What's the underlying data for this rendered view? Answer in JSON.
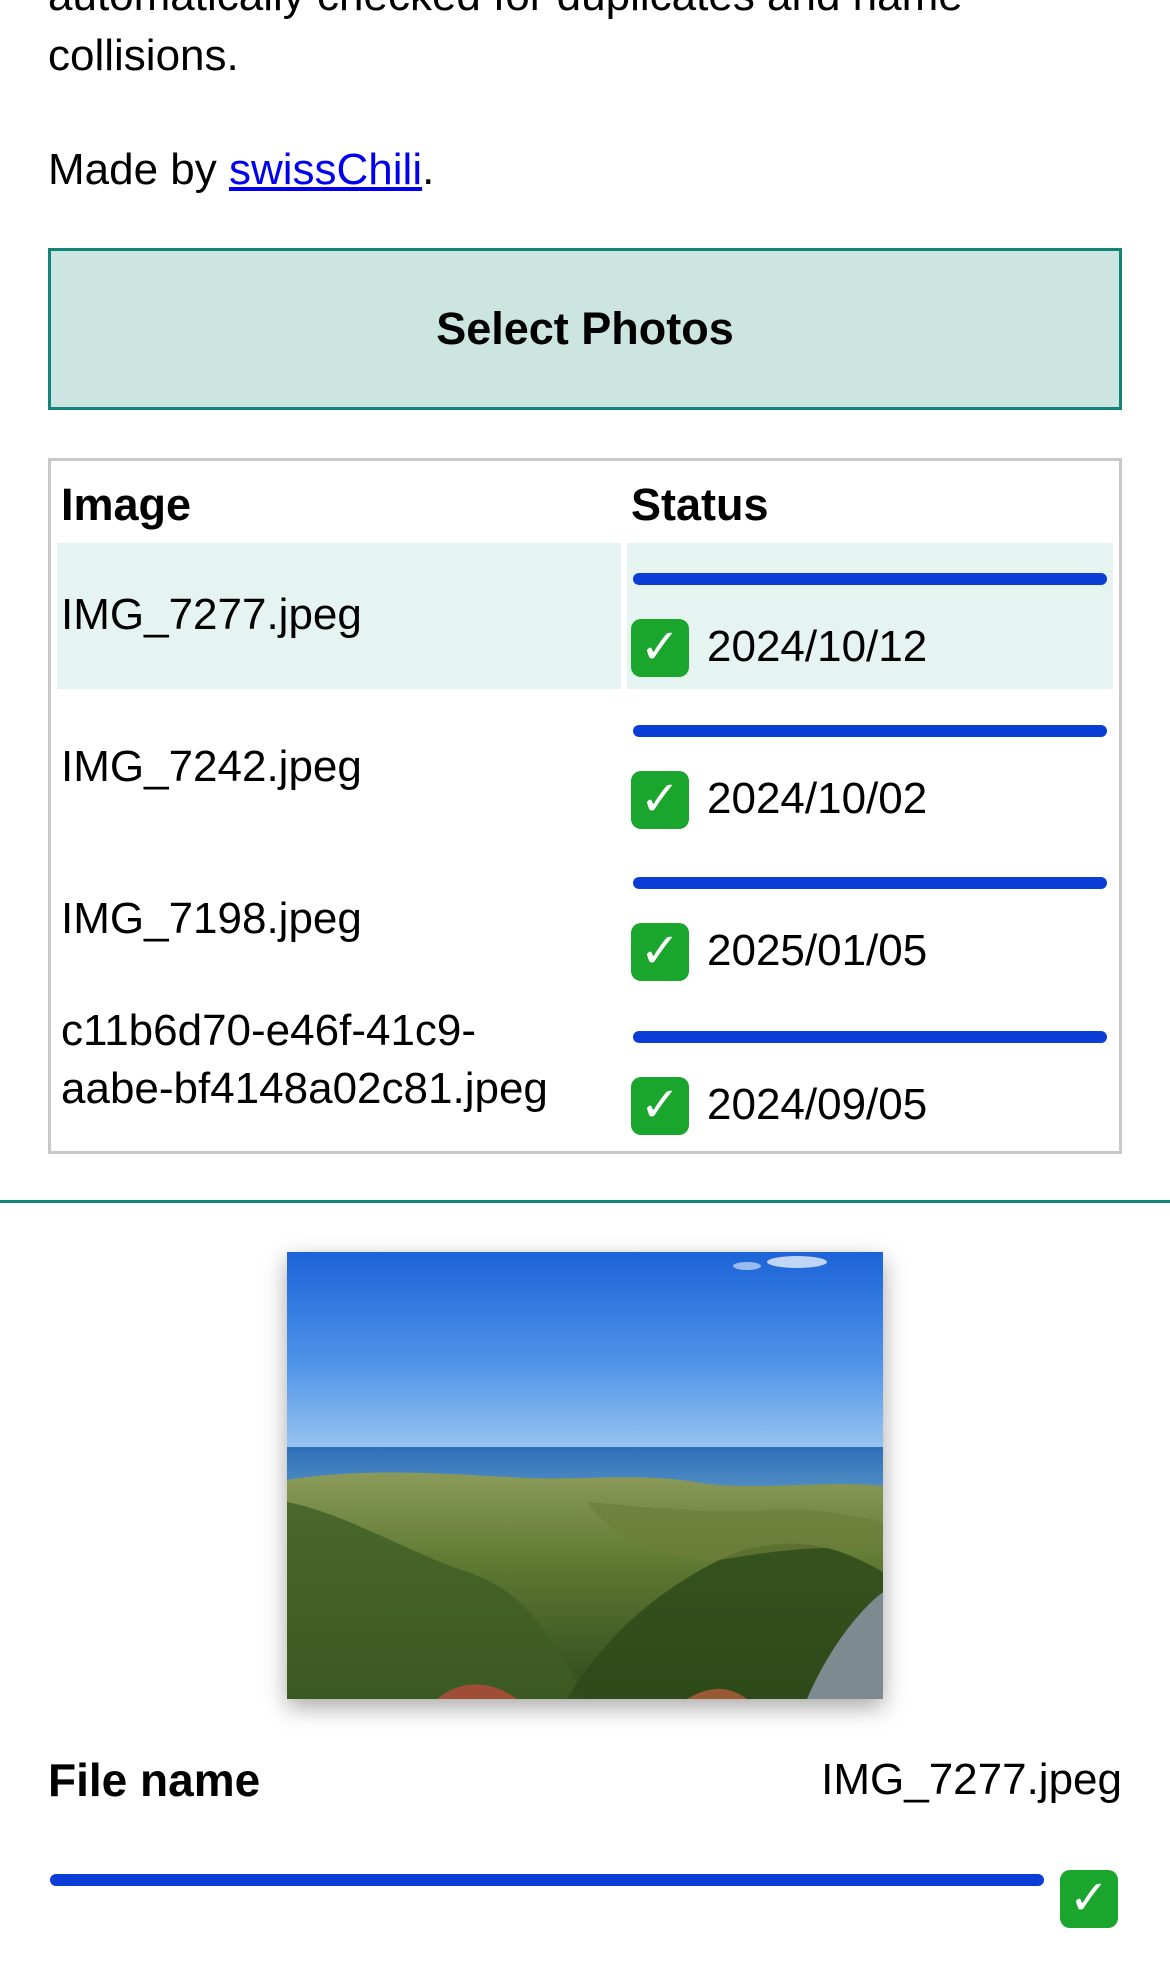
{
  "intro": {
    "text": "automatically checked for duplicates and name collisions."
  },
  "credit": {
    "prefix": "Made by ",
    "link_text": "swissChili",
    "suffix": "."
  },
  "select_button": {
    "label": "Select Photos"
  },
  "table": {
    "headers": [
      "Image",
      "Status"
    ],
    "rows": [
      {
        "name": "IMG_7277.jpeg",
        "date": "2024/10/12",
        "progress": 1.0,
        "highlighted": true
      },
      {
        "name": "IMG_7242.jpeg",
        "date": "2024/10/02",
        "progress": 1.0,
        "highlighted": false
      },
      {
        "name": "IMG_7198.jpeg",
        "date": "2025/01/05",
        "progress": 1.0,
        "highlighted": false
      },
      {
        "name_line1": "c11b6d70-e46f-41c9-",
        "name_line2": "aabe-bf4148a02c81.jpeg",
        "date": "2024/09/05",
        "progress": 1.0,
        "highlighted": false
      }
    ]
  },
  "status_icon": "check-mark-icon",
  "detail": {
    "file_name_label": "File name",
    "file_name_value": "IMG_7277.jpeg",
    "progress": 1.0
  },
  "colors": {
    "accent": "#14837a",
    "button_bg": "#cde5e1",
    "progress": "#0a3ed6",
    "check": "#1aa62c",
    "row_highlight": "#e5f3f1"
  }
}
